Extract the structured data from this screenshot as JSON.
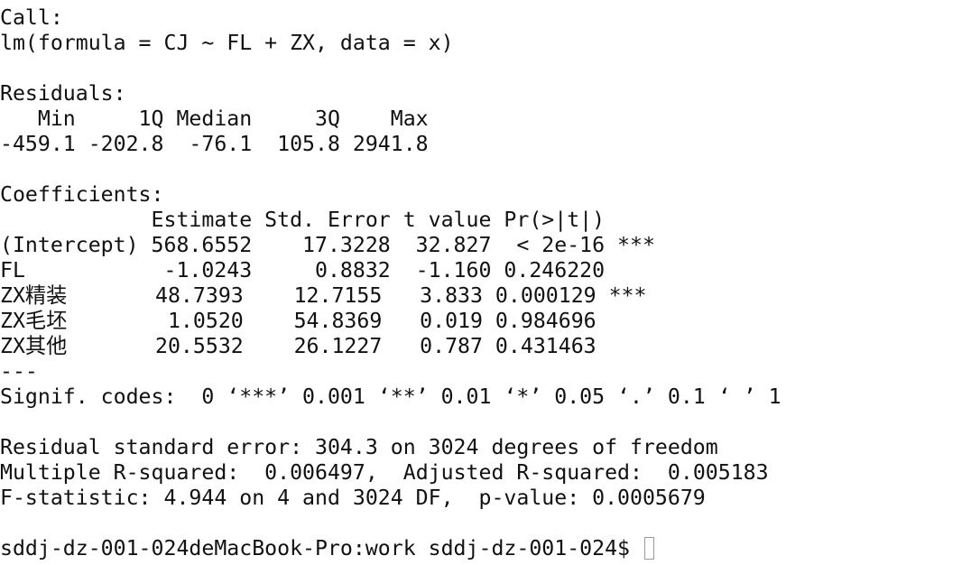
{
  "terminal": {
    "lines": [
      "Call:",
      "lm(formula = CJ ~ FL + ZX, data = x)",
      "",
      "Residuals:",
      "   Min     1Q Median     3Q    Max ",
      "-459.1 -202.8  -76.1  105.8 2941.8 ",
      "",
      "Coefficients:",
      "            Estimate Std. Error t value Pr(>|t|)    ",
      "(Intercept) 568.6552    17.3228  32.827  < 2e-16 ***",
      "FL           -1.0243     0.8832  -1.160 0.246220    ",
      "ZX精装       48.7393    12.7155   3.833 0.000129 ***",
      "ZX毛坯        1.0520    54.8369   0.019 0.984696    ",
      "ZX其他       20.5532    26.1227   0.787 0.431463    ",
      "---",
      "Signif. codes:  0 ‘***’ 0.001 ‘**’ 0.01 ‘*’ 0.05 ‘.’ 0.1 ‘ ’ 1",
      "",
      "Residual standard error: 304.3 on 3024 degrees of freedom",
      "Multiple R-squared:  0.006497,\tAdjusted R-squared:  0.005183 ",
      "F-statistic: 4.944 on 4 and 3024 DF,  p-value: 0.0005679",
      "",
      "sddj-dz-001-024deMacBook-Pro:work sddj-dz-001-024$ "
    ]
  }
}
